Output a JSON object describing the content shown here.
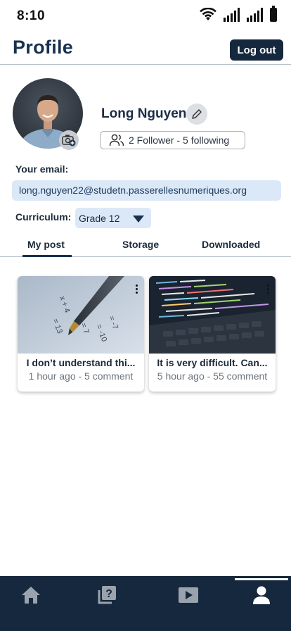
{
  "status_bar": {
    "time": "8:10"
  },
  "header": {
    "title": "Profile",
    "logout_label": "Log out"
  },
  "profile": {
    "name": "Long Nguyen",
    "follow_text": "2 Follower - 5 following",
    "email_label": "Your email:",
    "email_value": "long.nguyen22@studetn.passerellesnumeriques.org",
    "curriculum_label": "Curriculum:",
    "curriculum_value": "Grade 12"
  },
  "tabs": [
    {
      "label": "My post",
      "active": true
    },
    {
      "label": "Storage",
      "active": false
    },
    {
      "label": "Downloaded",
      "active": false
    }
  ],
  "posts": [
    {
      "title": "I don’t understand thi...",
      "meta": "1 hour ago - 5 comment"
    },
    {
      "title": "It is very difficult. Can...",
      "meta": "5 hour ago - 55 comment"
    }
  ],
  "bottom_nav": {
    "items": [
      {
        "icon": "home-icon",
        "active": false
      },
      {
        "icon": "question-book-icon",
        "active": false
      },
      {
        "icon": "video-play-icon",
        "active": false
      },
      {
        "icon": "user-icon",
        "active": true
      }
    ]
  },
  "colors": {
    "primary": "#16283d",
    "accent_light": "#dbe8f7",
    "title": "#17314f"
  }
}
